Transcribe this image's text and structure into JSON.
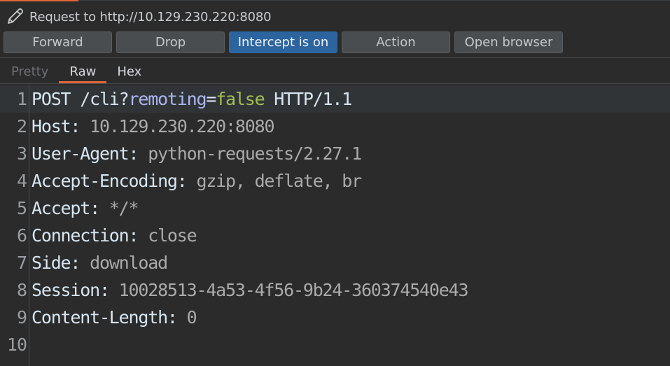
{
  "header": {
    "title": "Request to http://10.129.230.220:8080",
    "icon": "pencil-icon"
  },
  "toolbar": {
    "forward_label": "Forward",
    "drop_label": "Drop",
    "intercept_label": "Intercept is on",
    "action_label": "Action",
    "open_browser_label": "Open browser"
  },
  "tabs": [
    {
      "label": "Pretty",
      "active": false
    },
    {
      "label": "Raw",
      "active": true
    },
    {
      "label": "Hex",
      "active": false
    }
  ],
  "colors": {
    "accent": "#e0673a",
    "primary_button": "#2c64a0",
    "param_name": "#a8b6f0",
    "param_value": "#9fbf4f"
  },
  "request": {
    "lines": [
      {
        "num": "1",
        "method": "POST",
        "path": " /cli?",
        "param": "remoting",
        "eq": "=",
        "pvalue": "false",
        "proto": " HTTP/1.1"
      },
      {
        "num": "2",
        "name": "Host:",
        "value": " 10.129.230.220:8080"
      },
      {
        "num": "3",
        "name": "User-Agent:",
        "value": " python-requests/2.27.1"
      },
      {
        "num": "4",
        "name": "Accept-Encoding:",
        "value": " gzip, deflate, br"
      },
      {
        "num": "5",
        "name": "Accept:",
        "value": " */*"
      },
      {
        "num": "6",
        "name": "Connection:",
        "value": " close"
      },
      {
        "num": "7",
        "name": "Side:",
        "value": " download"
      },
      {
        "num": "8",
        "name": "Session:",
        "value": " 10028513-4a53-4f56-9b24-360374540e43"
      },
      {
        "num": "9",
        "name": "Content-Length:",
        "value": " 0"
      },
      {
        "num": "10",
        "name": "",
        "value": ""
      }
    ]
  }
}
